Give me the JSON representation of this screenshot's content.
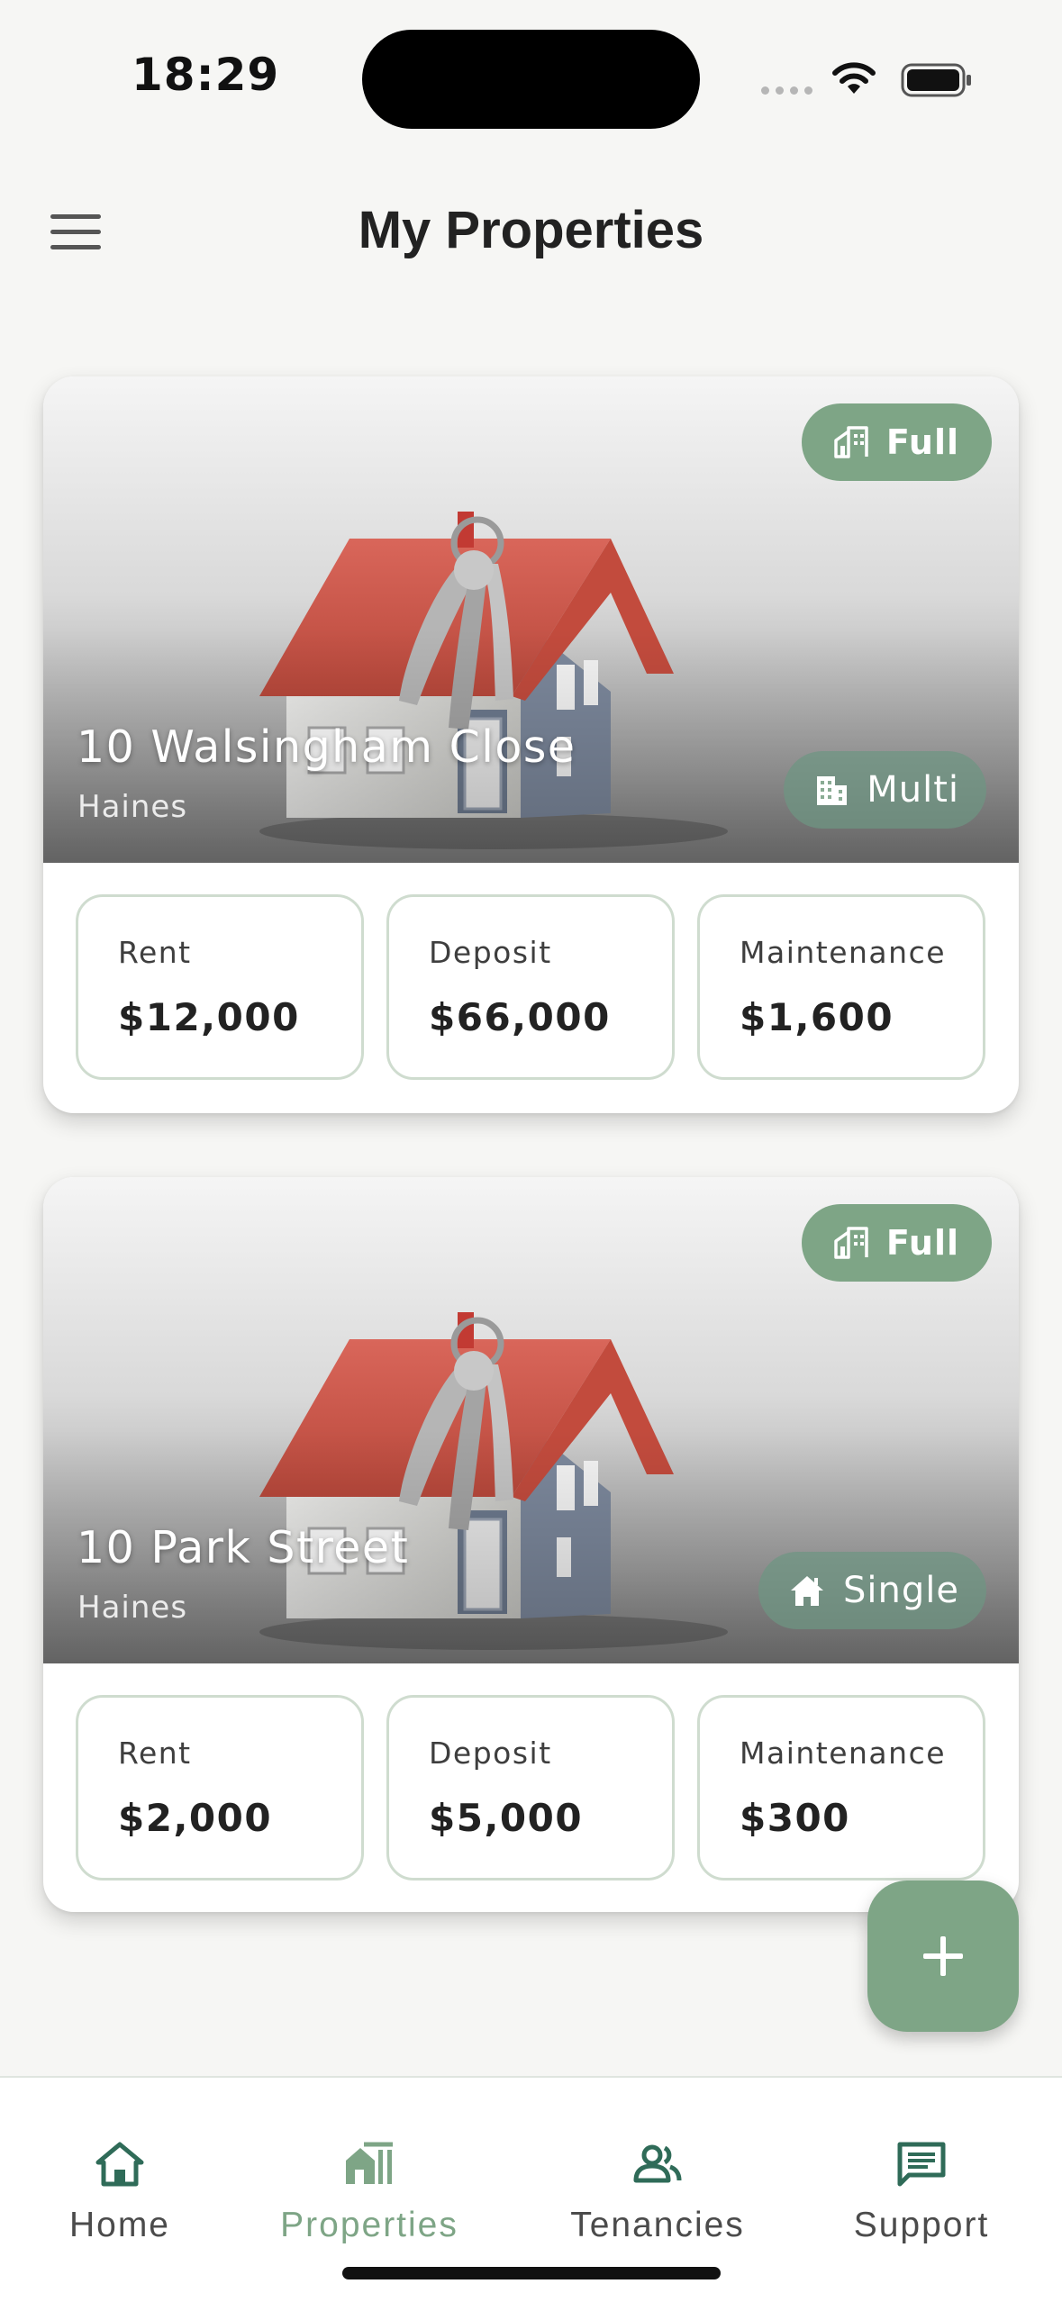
{
  "status_bar": {
    "time": "18:29"
  },
  "header": {
    "title": "My Properties",
    "menu_icon": "hamburger-menu-icon"
  },
  "properties": [
    {
      "address": "10 Walsingham Close",
      "city": "Haines",
      "occupancy": "Full",
      "occupancy_icon": "building-icon",
      "type": "Multi",
      "type_icon": "apartment-icon",
      "stats": [
        {
          "label": "Rent",
          "value": "$12,000"
        },
        {
          "label": "Deposit",
          "value": "$66,000"
        },
        {
          "label": "Maintenance",
          "value": "$1,600"
        }
      ]
    },
    {
      "address": "10 Park Street",
      "city": "Haines",
      "occupancy": "Full",
      "occupancy_icon": "building-icon",
      "type": "Single",
      "type_icon": "house-icon",
      "stats": [
        {
          "label": "Rent",
          "value": "$2,000"
        },
        {
          "label": "Deposit",
          "value": "$5,000"
        },
        {
          "label": "Maintenance",
          "value": "$300"
        }
      ]
    }
  ],
  "fab": {
    "icon": "plus-icon"
  },
  "bottom_nav": {
    "active": "Properties",
    "items": [
      {
        "label": "Home",
        "icon": "home-icon"
      },
      {
        "label": "Properties",
        "icon": "properties-icon"
      },
      {
        "label": "Tenancies",
        "icon": "people-icon"
      },
      {
        "label": "Support",
        "icon": "chat-icon"
      }
    ]
  },
  "colors": {
    "accent": "#7ea586",
    "nav_icon": "#2f6b58",
    "background": "#f6f6f4",
    "card_border": "#cfdccf"
  }
}
